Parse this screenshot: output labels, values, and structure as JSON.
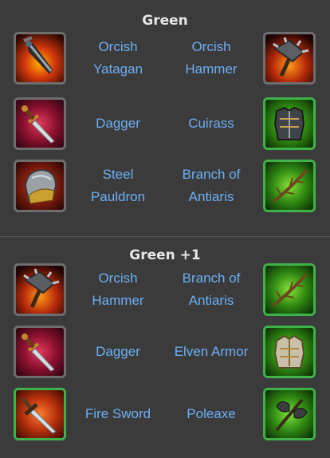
{
  "sections": [
    {
      "title": "Green",
      "rows": [
        {
          "left_label": "Orcish Yatagan",
          "right_label": "Orcish Hammer",
          "left_icon": "orcish-yatagan-icon",
          "right_icon": "orcish-hammer-icon",
          "left_frame": "gray",
          "right_frame": "gray"
        },
        {
          "left_label": "Dagger",
          "right_label": "Cuirass",
          "left_icon": "dagger-icon",
          "right_icon": "cuirass-icon",
          "left_frame": "gray",
          "right_frame": "green"
        },
        {
          "left_label": "Steel Pauldron",
          "right_label": "Branch of Antiaris",
          "left_icon": "steel-pauldron-icon",
          "right_icon": "branch-of-antiaris-icon",
          "left_frame": "gray",
          "right_frame": "green"
        }
      ]
    },
    {
      "title": "Green +1",
      "rows": [
        {
          "left_label": "Orcish Hammer",
          "right_label": "Branch of Antiaris",
          "left_icon": "orcish-hammer-icon",
          "right_icon": "branch-of-antiaris-icon",
          "left_frame": "gray",
          "right_frame": "green"
        },
        {
          "left_label": "Dagger",
          "right_label": "Elven Armor",
          "left_icon": "dagger-icon",
          "right_icon": "elven-armor-icon",
          "left_frame": "gray",
          "right_frame": "green"
        },
        {
          "left_label": "Fire Sword",
          "right_label": "Poleaxe",
          "left_icon": "fire-sword-icon",
          "right_icon": "poleaxe-icon",
          "left_frame": "green",
          "right_frame": "green"
        }
      ]
    }
  ],
  "colors": {
    "background": "#3b3b3b",
    "title": "#e8e8e8",
    "label": "#6cb0f5",
    "frame_gray": "#6e6e6e",
    "frame_green": "#3fb24a"
  }
}
